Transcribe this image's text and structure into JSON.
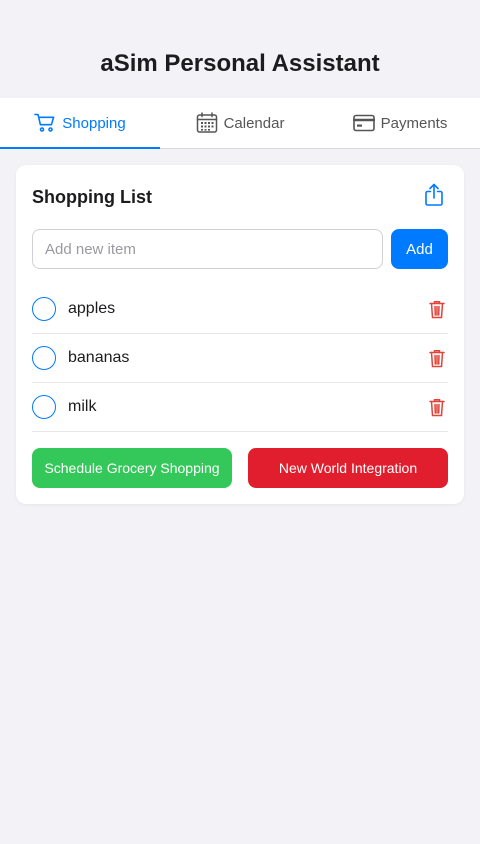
{
  "app": {
    "title": "aSim Personal Assistant"
  },
  "tabs": [
    {
      "label": "Shopping",
      "icon": "cart-icon",
      "active": true
    },
    {
      "label": "Calendar",
      "icon": "calendar-icon",
      "active": false
    },
    {
      "label": "Payments",
      "icon": "credit-card-icon",
      "active": false
    }
  ],
  "shopping": {
    "title": "Shopping List",
    "input_placeholder": "Add new item",
    "input_value": "",
    "add_label": "Add",
    "items": [
      {
        "label": "apples",
        "checked": false
      },
      {
        "label": "bananas",
        "checked": false
      },
      {
        "label": "milk",
        "checked": false
      }
    ],
    "schedule_label": "Schedule Grocery Shopping",
    "integration_label": "New World Integration"
  },
  "colors": {
    "accent": "#007aff",
    "green": "#34c759",
    "red": "#e01e2d",
    "trash": "#e0443a"
  }
}
